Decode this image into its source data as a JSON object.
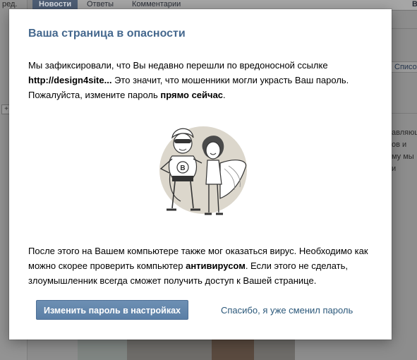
{
  "background": {
    "side_label": "ред.",
    "plus_glyph": "+",
    "tabs": [
      {
        "label": "Новости",
        "active": true
      },
      {
        "label": "Ответы",
        "active": false
      },
      {
        "label": "Комментарии",
        "active": false
      }
    ],
    "top_right_glyph": "В",
    "spisok_label": "Списо",
    "side_text_lines": [
      "авляющ",
      "ов и",
      "му мы и"
    ]
  },
  "modal": {
    "title": "Ваша страница в опасности",
    "para1": {
      "intro": "Мы зафиксировали, что Вы недавно перешли по вредоносной ссылке",
      "link": "http://design4site...",
      "middle": " Это значит, что мошенники могли украсть Ваш пароль. Пожалуйста, измените пароль ",
      "emphasis": "прямо сейчас",
      "end": "."
    },
    "para2": {
      "intro": "После этого на Вашем компьютере также мог оказаться вирус. Необходимо как можно скорее проверить компьютер ",
      "emphasis": "антивирусом",
      "end": ". Если этого не сделать, злоумышленник всегда сможет получить доступ к Вашей странице."
    },
    "illustration": {
      "icon": "superhero-couple-illustration",
      "badge_letter": "B"
    },
    "change_password_button": "Изменить пароль в настройках",
    "thanks_link": "Спасибо, я уже сменил пароль",
    "colors": {
      "title": "#45688e",
      "button": "#5b7fa6",
      "link": "#2b587a"
    }
  }
}
